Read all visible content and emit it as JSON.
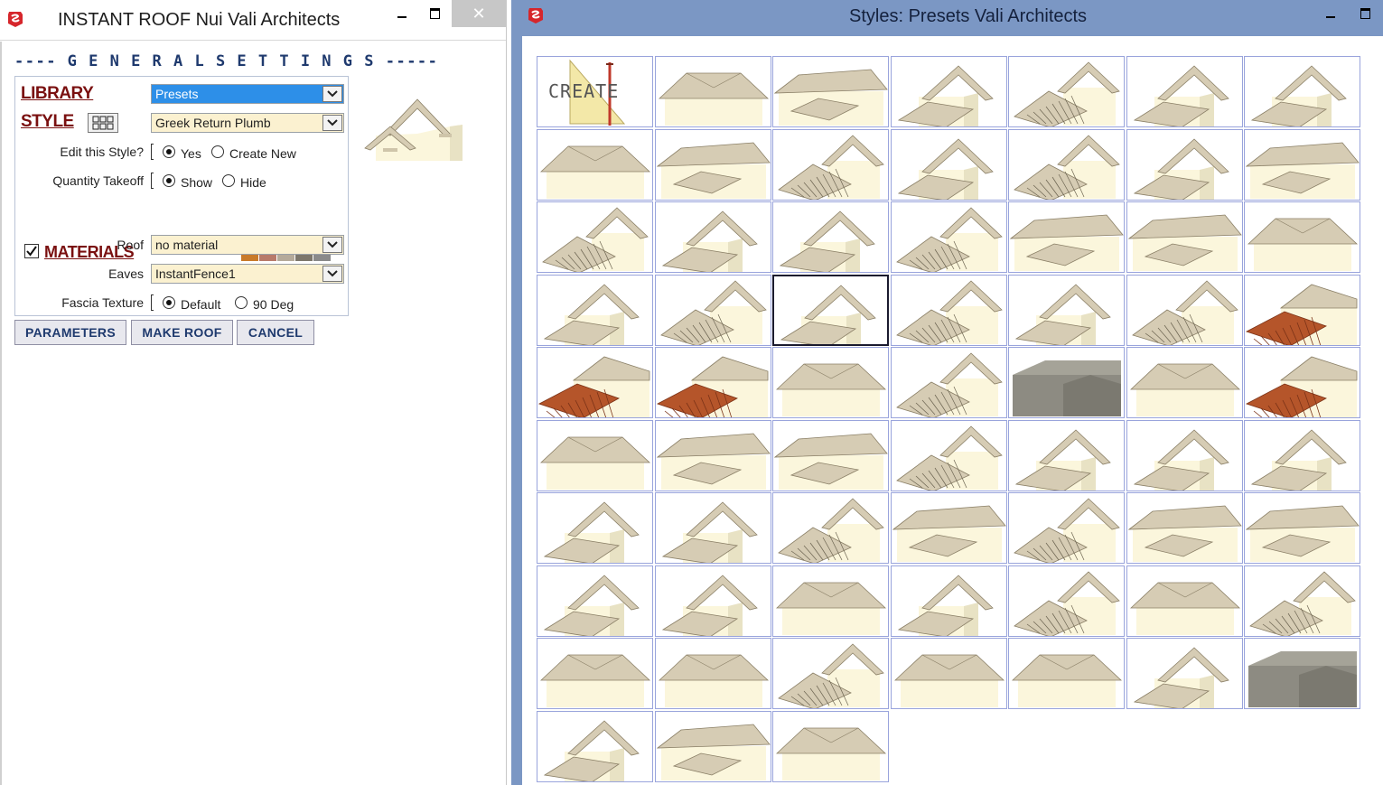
{
  "left_window": {
    "title": "INSTANT ROOF Nui   Vali Architects",
    "close_glyph": "✕",
    "header": "---- G E N E R A L   S E T T I N G S -----",
    "library_label": "LIBRARY",
    "library_value": "Presets",
    "style_label": "STYLE",
    "style_value": "Greek Return Plumb",
    "edit_label": "Edit this Style?",
    "edit_yes": "Yes",
    "edit_create": "Create New",
    "qty_label": "Quantity Takeoff",
    "qty_show": "Show",
    "qty_hide": "Hide",
    "materials_label": "MATERIALS",
    "materials_checked": true,
    "swatch_colors": [
      "#c97a2a",
      "#b87a6a",
      "#b5aa9a",
      "#7d776c",
      "#8a8a8a"
    ],
    "roof_label": "Roof",
    "roof_value": "no material",
    "eaves_label": "Eaves",
    "eaves_value": "InstantFence1",
    "fascia_label": "Fascia Texture",
    "fascia_default": "Default",
    "fascia_90": "90 Deg",
    "buttons": {
      "parameters": "PARAMETERS",
      "make_roof": "MAKE ROOF",
      "cancel": "CANCEL"
    }
  },
  "right_window": {
    "title": "Styles: Presets    Vali Architects",
    "create_tile_label": "CREATE",
    "grid_columns": 7,
    "selected_index": 23,
    "thumbnail_styles": [
      "create",
      "hip",
      "ridge",
      "gable",
      "vent",
      "gable",
      "gable",
      "hip",
      "ridge",
      "vent",
      "gable",
      "vent",
      "gable",
      "ridge",
      "vent",
      "gable",
      "gable",
      "vent",
      "ridge",
      "ridge",
      "hip",
      "gable",
      "vent",
      "gable",
      "vent",
      "gable",
      "vent",
      "tile",
      "tile",
      "tile",
      "hip",
      "vent",
      "flat",
      "hip",
      "tile",
      "hip",
      "ridge",
      "ridge",
      "vent",
      "gable",
      "gable",
      "gable",
      "gable",
      "gable",
      "vent",
      "ridge",
      "vent",
      "ridge",
      "ridge",
      "gable",
      "gable",
      "hip",
      "gable",
      "vent",
      "hip",
      "vent",
      "hip",
      "hip",
      "vent",
      "hip",
      "hip",
      "gable",
      "flat",
      "gable",
      "ridge",
      "hip"
    ]
  },
  "colors": {
    "accent_blue": "#2d8fe8",
    "title_blue": "#1f3a6e",
    "link_red": "#7a1010",
    "roof_tan": "#d6ccb4",
    "wall_cream": "#fbf6dc",
    "tile_terracotta": "#b5552a",
    "grid_border": "#99a4dc",
    "frame_blue": "#7b97c4"
  }
}
